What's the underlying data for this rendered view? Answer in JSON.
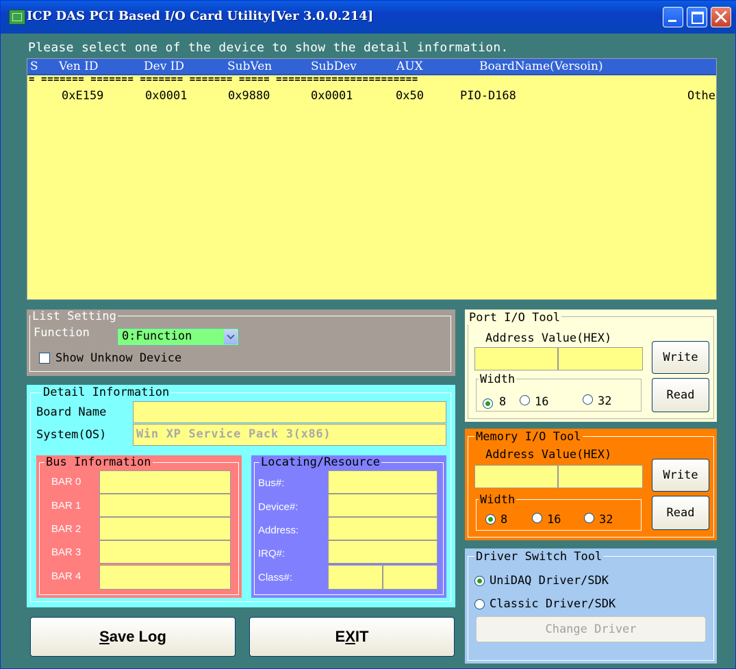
{
  "window": {
    "title": "ICP DAS PCI Based I/O Card Utility[Ver 3.0.0.214]"
  },
  "prompt": "Please select one of the device to show the detail information.",
  "device_list": {
    "columns": [
      "S",
      "Ven ID",
      "Dev ID",
      "SubVen",
      "SubDev",
      "AUX",
      "BoardName(Versoin)"
    ],
    "separator": "= ======= ======= ======= ======= ===== =======================",
    "rows": [
      {
        "ven": "0xE159",
        "dev": "0x0001",
        "subven": "0x9880",
        "subdev": "0x0001",
        "aux": "0x50",
        "board": "PIO-D168",
        "extra": "Othe"
      }
    ]
  },
  "list_setting": {
    "title": "List Setting",
    "function_label": "Function",
    "function_value": "0:Function",
    "show_unknown_label": "Show Unknow Device"
  },
  "detail": {
    "title": "Detail Information",
    "board_name_label": "Board Name",
    "board_name_value": "",
    "system_label": "System(OS)",
    "system_value": "Win XP Service Pack 3(x86)",
    "bus": {
      "title": "Bus Information",
      "labels": [
        "BAR 0",
        "BAR 1",
        "BAR 2",
        "BAR 3",
        "BAR 4"
      ]
    },
    "locating": {
      "title": "Locating/Resource",
      "labels": [
        "Bus#:",
        "Device#:",
        "Address:",
        "IRQ#:",
        "Class#:"
      ]
    }
  },
  "port_io": {
    "title": "Port I/O Tool",
    "addr_label": "Address Value(HEX)",
    "width_label": "Width",
    "widths": [
      "8",
      "16",
      "32"
    ],
    "selected": "8",
    "write_label": "Write",
    "read_label": "Read"
  },
  "mem_io": {
    "title": "Memory I/O Tool",
    "addr_label": "Address Value(HEX)",
    "width_label": "Width",
    "widths": [
      "8",
      "16",
      "32"
    ],
    "selected": "8",
    "write_label": "Write",
    "read_label": "Read"
  },
  "driver": {
    "title": "Driver Switch Tool",
    "options": [
      "UniDAQ Driver/SDK",
      "Classic Driver/SDK"
    ],
    "selected": "UniDAQ Driver/SDK",
    "change_label": "Change Driver"
  },
  "buttons": {
    "save_log": "Save Log",
    "save_log_hotkey": "S",
    "save_log_rest": "ave Log",
    "exit_pre": "E",
    "exit_hotkey": "X",
    "exit_post": "IT"
  },
  "colors": {
    "title_bar": "#0a4fd6",
    "window_bg": "#3d7b7b",
    "list_bg": "#ffff88",
    "header_bg": "#3163d6",
    "list_setting_bg": "#a69e96",
    "detail_bg": "#80ffff",
    "bus_bg": "#ff7f7f",
    "locating_bg": "#8080ff",
    "port_bg": "#ffffdc",
    "mem_bg": "#ff8000",
    "driver_bg": "#a6caf0",
    "function_select_bg": "#80ff80"
  }
}
